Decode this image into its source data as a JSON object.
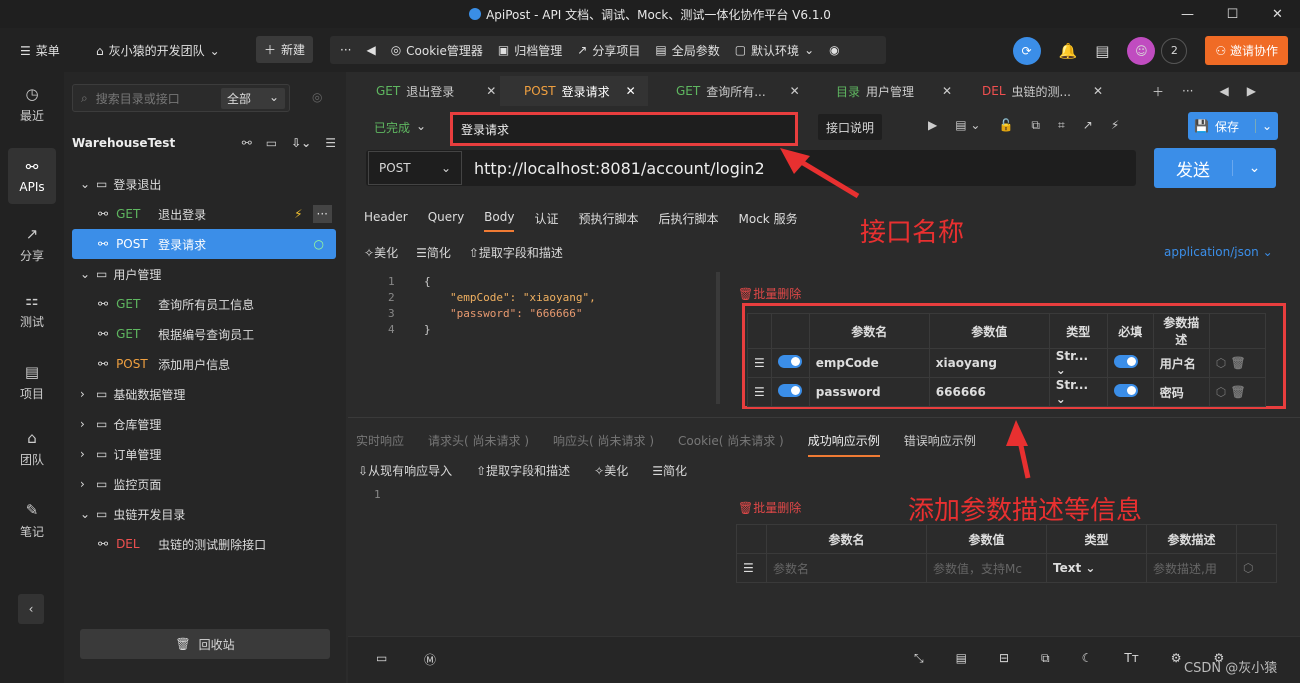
{
  "titlebar": {
    "title": "ApiPost - API 文档、调试、Mock、测试一体化协作平台 V6.1.0"
  },
  "menubar": {
    "menu": "菜单",
    "team": "灰小猿的开发团队",
    "new": "新建",
    "cookie": "Cookie管理器",
    "archive": "归档管理",
    "share": "分享项目",
    "params": "全局参数",
    "env": "默认环境",
    "count": "2",
    "invite": "邀请协作"
  },
  "leftnav": [
    {
      "label": "最近"
    },
    {
      "label": "APIs"
    },
    {
      "label": "分享"
    },
    {
      "label": "测试"
    },
    {
      "label": "项目"
    },
    {
      "label": "团队"
    },
    {
      "label": "笔记"
    }
  ],
  "sidebar": {
    "search_placeholder": "搜索目录或接口",
    "filter": "全部",
    "project": "WarehouseTest",
    "recycle": "回收站",
    "tree": [
      {
        "type": "folder",
        "label": "登录退出"
      },
      {
        "type": "api",
        "method": "GET",
        "label": "退出登录"
      },
      {
        "type": "api",
        "method": "POST",
        "label": "登录请求"
      },
      {
        "type": "folder",
        "label": "用户管理"
      },
      {
        "type": "api",
        "method": "GET",
        "label": "查询所有员工信息"
      },
      {
        "type": "api",
        "method": "GET",
        "label": "根据编号查询员工"
      },
      {
        "type": "api",
        "method": "POST",
        "label": "添加用户信息"
      },
      {
        "type": "folder",
        "label": "基础数据管理"
      },
      {
        "type": "folder",
        "label": "仓库管理"
      },
      {
        "type": "folder",
        "label": "订单管理"
      },
      {
        "type": "folder",
        "label": "监控页面"
      },
      {
        "type": "folder",
        "label": "虫链开发目录"
      },
      {
        "type": "api",
        "method": "DEL",
        "label": "虫链的测试删除接口"
      }
    ]
  },
  "tabs": [
    {
      "method": "GET",
      "label": "退出登录"
    },
    {
      "method": "POST",
      "label": "登录请求"
    },
    {
      "method": "GET",
      "label": "查询所有..."
    },
    {
      "method": "目录",
      "label": "用户管理"
    },
    {
      "method": "DEL",
      "label": "虫链的测..."
    }
  ],
  "request": {
    "status": "已完成",
    "name": "登录请求",
    "doc_btn": "接口说明",
    "save": "保存",
    "method": "POST",
    "url": "http://localhost:8081/account/login2",
    "send": "发送"
  },
  "subtabs": [
    "Header",
    "Query",
    "Body",
    "认证",
    "预执行脚本",
    "后执行脚本",
    "Mock 服务"
  ],
  "body_tools": {
    "beautify": "美化",
    "simplify": "简化",
    "extract": "提取字段和描述",
    "content_type": "application/json",
    "batch_delete": "批量删除"
  },
  "code_lines": [
    "{",
    "\"empCode\": \"xiaoyang\",",
    "\"password\": \"666666\"",
    "}"
  ],
  "param_headers": [
    "参数名",
    "参数值",
    "类型",
    "必填",
    "参数描述"
  ],
  "params": [
    {
      "name": "empCode",
      "value": "xiaoyang",
      "type": "Str...",
      "desc": "用户名"
    },
    {
      "name": "password",
      "value": "666666",
      "type": "Str...",
      "desc": "密码"
    }
  ],
  "annotations": {
    "name": "接口名称",
    "desc": "添加参数描述等信息"
  },
  "resp_tabs": [
    "实时响应",
    "请求头( 尚未请求 )",
    "响应头( 尚未请求 )",
    "Cookie( 尚未请求 )",
    "成功响应示例",
    "错误响应示例"
  ],
  "resp_tools": {
    "import": "从现有响应导入",
    "extract": "提取字段和描述",
    "beautify": "美化",
    "simplify": "简化",
    "batch_delete": "批量删除"
  },
  "resp_headers": [
    "参数名",
    "参数值",
    "类型",
    "参数描述"
  ],
  "resp_row": {
    "name_ph": "参数名",
    "value_ph": "参数值，支持Mc",
    "type": "Text",
    "desc_ph": "参数描述,用"
  },
  "watermark": "CSDN @灰小猿"
}
